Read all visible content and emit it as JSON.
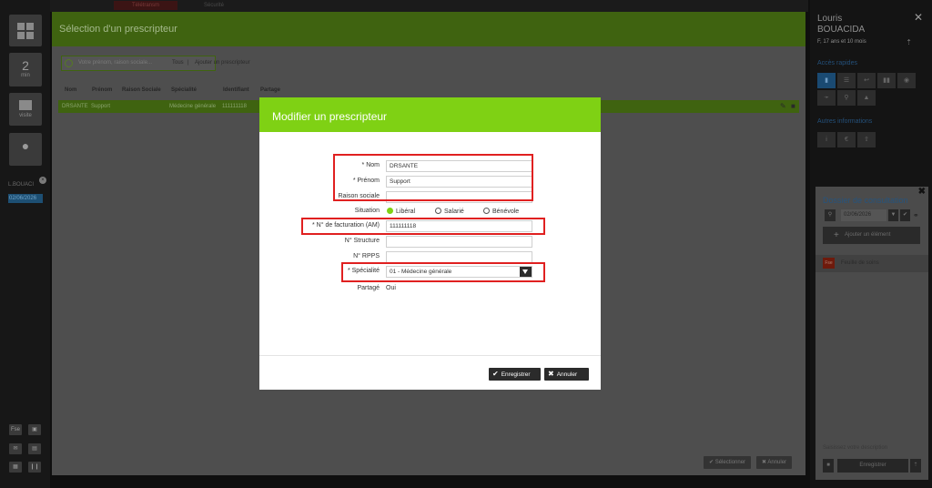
{
  "sidebar": {
    "count": "2",
    "count_unit": "min",
    "visit_label": "visite",
    "patient_short": "L.BOUACI",
    "patient_date": "02/06/2026",
    "mini": [
      "Fse",
      "▣",
      "✉",
      "▤",
      "▦",
      "❙❙"
    ]
  },
  "topstrip": {
    "t1": "Télétransm",
    "t2": "Sécurité"
  },
  "back": {
    "title": "Sélection d'un prescripteur",
    "search_placeholder": "Votre prénom, raison sociale...",
    "filter_all": "Tous",
    "filter_sep": "|",
    "filter_add": "Ajouter un prescripteur",
    "columns": [
      "Nom",
      "Prénom",
      "Raison Sociale",
      "Spécialité",
      "Identifiant",
      "Partage"
    ],
    "row": {
      "nom": "DRSANTE",
      "prenom": "Support",
      "specialite": "Médecine générale",
      "identifiant": "111111118"
    },
    "select_label": "Sélectionner",
    "cancel_label": "Annuler"
  },
  "right": {
    "first_name": "Louris",
    "last_name": "BOUACIDA",
    "age": "F, 17 ans et 10 mois",
    "section1": "Accès rapides",
    "section2": "Autres informations",
    "card_title": "Dossier de consultation",
    "card_date": "02/06/2026",
    "add_label": "Ajouter un élément",
    "feuille_label": "Feuille de soins",
    "fse_label": "Fse",
    "footer_text": "Saisissez votre description",
    "save_label": "Enregistrer"
  },
  "modal": {
    "title": "Modifier un prescripteur",
    "labels": {
      "nom": "* Nom",
      "prenom": "* Prénom",
      "raison": "Raison sociale",
      "situation": "Situation",
      "facturation": "* N° de facturation (AM)",
      "structure": "N° Structure",
      "rpps": "N° RPPS",
      "specialite": "* Spécialité",
      "partage": "Partagé"
    },
    "values": {
      "nom": "DRSANTE",
      "prenom": "Support",
      "raison": "",
      "facturation": "111111118",
      "structure": "",
      "rpps": "",
      "specialite": "01 - Médecine générale",
      "partage": "Oui"
    },
    "situation_options": [
      "Libéral",
      "Salarié",
      "Bénévole"
    ],
    "situation_selected": "Libéral",
    "save_label": "Enregistrer",
    "cancel_label": "Annuler"
  },
  "colors": {
    "accent_green": "#7fd114",
    "highlight_red": "#e02020",
    "blue": "#1a4a72"
  }
}
